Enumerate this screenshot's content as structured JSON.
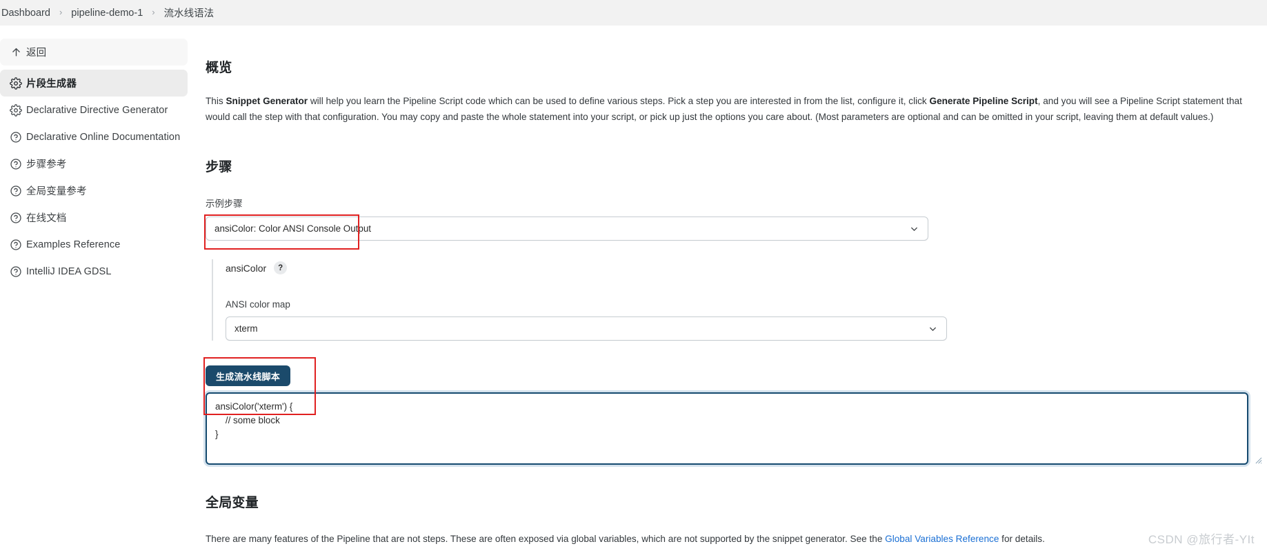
{
  "breadcrumb": {
    "items": [
      {
        "label": "Dashboard"
      },
      {
        "label": "pipeline-demo-1"
      },
      {
        "label": "流水线语法"
      }
    ],
    "separator": "›"
  },
  "sidebar": {
    "items": [
      {
        "label": "返回",
        "icon": "arrow-up-icon",
        "name": "back",
        "state": "hover"
      },
      {
        "label": "片段生成器",
        "icon": "gear-icon",
        "name": "snippet-generator",
        "state": "active"
      },
      {
        "label": "Declarative Directive Generator",
        "icon": "gear-icon",
        "name": "declarative-directive-generator",
        "state": "normal"
      },
      {
        "label": "Declarative Online Documentation",
        "icon": "question-icon",
        "name": "declarative-online-documentation",
        "state": "normal"
      },
      {
        "label": "步骤参考",
        "icon": "question-icon",
        "name": "steps-reference",
        "state": "normal"
      },
      {
        "label": "全局变量参考",
        "icon": "question-icon",
        "name": "global-variables-reference",
        "state": "normal"
      },
      {
        "label": "在线文档",
        "icon": "question-icon",
        "name": "online-docs",
        "state": "normal"
      },
      {
        "label": "Examples Reference",
        "icon": "question-icon",
        "name": "examples-reference",
        "state": "normal"
      },
      {
        "label": "IntelliJ IDEA GDSL",
        "icon": "question-icon",
        "name": "intellij-idea-gdsl",
        "state": "normal"
      }
    ]
  },
  "overview": {
    "heading": "概览",
    "para_1": "This ",
    "bold_1": "Snippet Generator",
    "para_2": " will help you learn the Pipeline Script code which can be used to define various steps. Pick a step you are interested in from the list, configure it, click ",
    "bold_2": "Generate Pipeline Script",
    "para_3": ", and you will see a Pipeline Script statement that would call the step with that configuration. You may copy and paste the whole statement into your script, or pick up just the options you care about. (Most parameters are optional and can be omitted in your script, leaving them at default values.)"
  },
  "steps": {
    "heading": "步骤",
    "sample_step_label": "示例步骤",
    "sample_step_value": "ansiColor: Color ANSI Console Output",
    "block": {
      "title": "ansiColor",
      "help_badge": "?",
      "color_map_label": "ANSI color map",
      "color_map_value": "xterm"
    },
    "generate_button": "生成流水线脚本",
    "generated_script": "ansiColor('xterm') {\n    // some block\n}"
  },
  "global_variables": {
    "heading": "全局变量",
    "para_1": "There are many features of the Pipeline that are not steps. These are often exposed via global variables, which are not supported by the snippet generator. See the ",
    "link": "Global Variables Reference",
    "para_2": " for details."
  },
  "watermark": "CSDN @旅行者-YIt",
  "colors": {
    "accent_button": "#1b4a6b",
    "focus_border": "#14496e",
    "annotation": "#e02020",
    "link": "#1a6fd4",
    "sidebar_active_bg": "#ececec"
  }
}
